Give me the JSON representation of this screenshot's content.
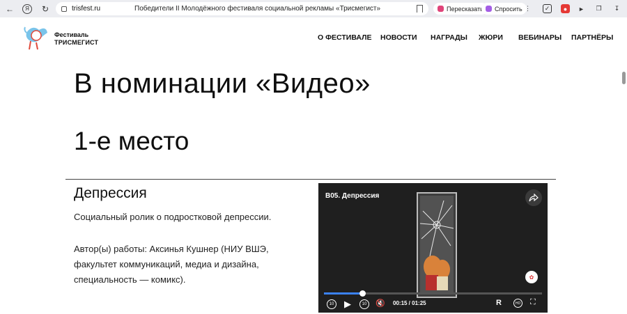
{
  "browser": {
    "domain": "trisfest.ru",
    "page_title": "Победители II Молодёжного фестиваля социальной рекламы «Трисмегист»",
    "retell_label": "Пересказать",
    "ask_label": "Спросить"
  },
  "site": {
    "logo_line1": "Фестиваль",
    "logo_line2": "ТРИСМЕГИСТ",
    "nav": [
      "О ФЕСТИВАЛЕ",
      "НОВОСТИ",
      "НАГРАДЫ",
      "ЖЮРИ",
      "ВЕБИНАРЫ",
      "ПАРТНЁРЫ"
    ]
  },
  "content": {
    "heading": "В номинации «Видео»",
    "place": "1-е место",
    "work_title": "Депрессия",
    "description": "Социальный ролик о подростковой депрессии.",
    "author": "Автор(ы) работы: Аксинья Кушнер (НИУ ВШЭ, факультет коммуникаций, медиа и дизайна, специальность — комикс)."
  },
  "video": {
    "title": "В05. Депрессия",
    "time": "00:15 / 01:25",
    "progress": 0.176,
    "rewind_label": "10",
    "forward_label": "10",
    "quality_label": "HD",
    "accent_color": "#3b82f6"
  }
}
